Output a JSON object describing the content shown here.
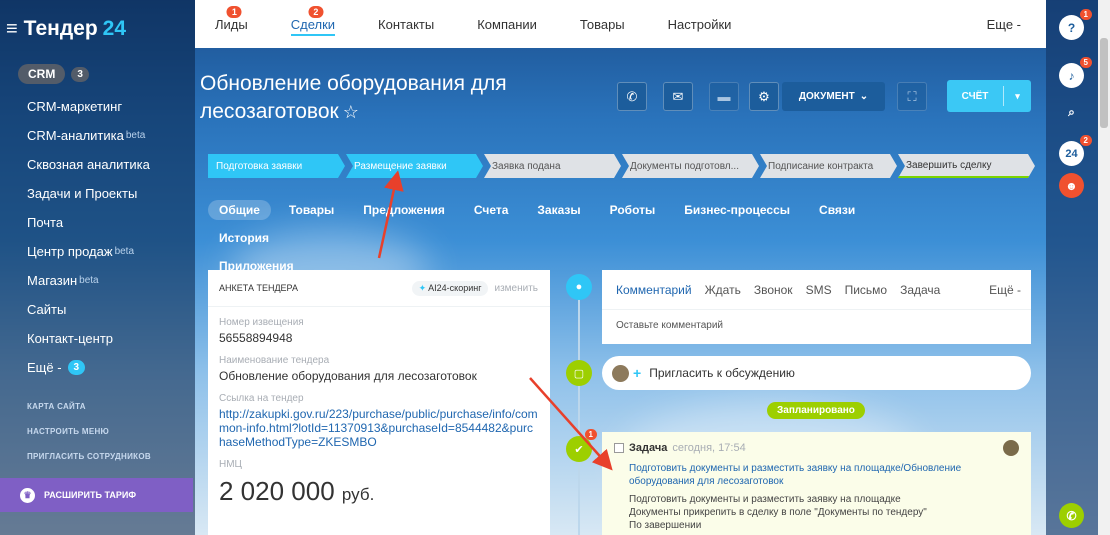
{
  "sidebar": {
    "logo_text": "Тендер",
    "logo_num": "24",
    "crm_label": "CRM",
    "crm_count": "3",
    "items": [
      {
        "label": "CRM-маркетинг",
        "sup": ""
      },
      {
        "label": "CRM-аналитика",
        "sup": "beta"
      },
      {
        "label": "Сквозная аналитика",
        "sup": ""
      },
      {
        "label": "Задачи и Проекты",
        "sup": ""
      },
      {
        "label": "Почта",
        "sup": ""
      },
      {
        "label": "Центр продаж",
        "sup": "beta"
      },
      {
        "label": "Магазин",
        "sup": "beta"
      },
      {
        "label": "Сайты",
        "sup": ""
      },
      {
        "label": "Контакт-центр",
        "sup": ""
      }
    ],
    "more_label": "Ещё -",
    "more_count": "3",
    "links": [
      "КАРТА САЙТА",
      "НАСТРОИТЬ МЕНЮ",
      "ПРИГЛАСИТЬ СОТРУДНИКОВ"
    ],
    "upgrade_label": "РАСШИРИТЬ ТАРИФ"
  },
  "topnav": {
    "items": [
      {
        "label": "Лиды",
        "badge": "1"
      },
      {
        "label": "Сделки",
        "badge": "2"
      },
      {
        "label": "Контакты",
        "badge": ""
      },
      {
        "label": "Компании",
        "badge": ""
      },
      {
        "label": "Товары",
        "badge": ""
      },
      {
        "label": "Настройки",
        "badge": ""
      }
    ],
    "more": "Еще -"
  },
  "rail": {
    "help_badge": "1",
    "bell_badge": "5",
    "b24_label": "24",
    "b24_badge": "2"
  },
  "deal": {
    "title": "Обновление оборудования для лесозаготовок",
    "doc_button": "ДОКУМЕНТ",
    "invoice_button": "СЧЁТ"
  },
  "pipeline": [
    {
      "label": "Подготовка заявки",
      "state": "done"
    },
    {
      "label": "Размещение заявки",
      "state": "done"
    },
    {
      "label": "Заявка подана",
      "state": "todo"
    },
    {
      "label": "Документы подготовл...",
      "state": "todo"
    },
    {
      "label": "Подписание контракта",
      "state": "todo"
    },
    {
      "label": "Завершить сделку",
      "state": "last"
    }
  ],
  "tabs": [
    "Общие",
    "Товары",
    "Предложения",
    "Счета",
    "Заказы",
    "Роботы",
    "Бизнес-процессы",
    "Связи",
    "История",
    "Приложения"
  ],
  "tender_card": {
    "title": "АНКЕТА ТЕНДЕРА",
    "ai_label": "AI24-скоринг",
    "edit_label": "изменить",
    "notice_label": "Номер извещения",
    "notice_value": "56558894948",
    "name_label": "Наименование тендера",
    "name_value": "Обновление оборудования для лесозаготовок",
    "link_label": "Ссылка на тендер",
    "link_value": "http://zakupki.gov.ru/223/purchase/public/purchase/info/common-info.html?lotId=11370913&purchaseId=8544482&purchaseMethodType=ZKESMBO",
    "nmc_label": "НМЦ",
    "nmc_value": "2 020 000",
    "nmc_unit": "руб."
  },
  "comment_card": {
    "tabs": [
      "Комментарий",
      "Ждать",
      "Звонок",
      "SMS",
      "Письмо",
      "Задача"
    ],
    "more": "Ещё -",
    "placeholder": "Оставьте комментарий"
  },
  "invite": "Пригласить к обсуждению",
  "planned": "Запланировано",
  "task": {
    "title": "Задача",
    "time": "сегодня, 17:54",
    "link": "Подготовить документы и разместить заявку на площадке/Обновление оборудования для лесозаготовок",
    "lines": [
      "Подготовить документы и разместить заявку на площадке",
      "Документы прикрепить в сделку в поле \"Документы по тендеру\"",
      "По завершении"
    ],
    "badge": "1"
  },
  "colors": {
    "accent": "#2fc6f6",
    "link": "#2067b0",
    "badge": "#f0512f",
    "planned": "#9dcf00",
    "upgrade": "#7f5fc5"
  }
}
